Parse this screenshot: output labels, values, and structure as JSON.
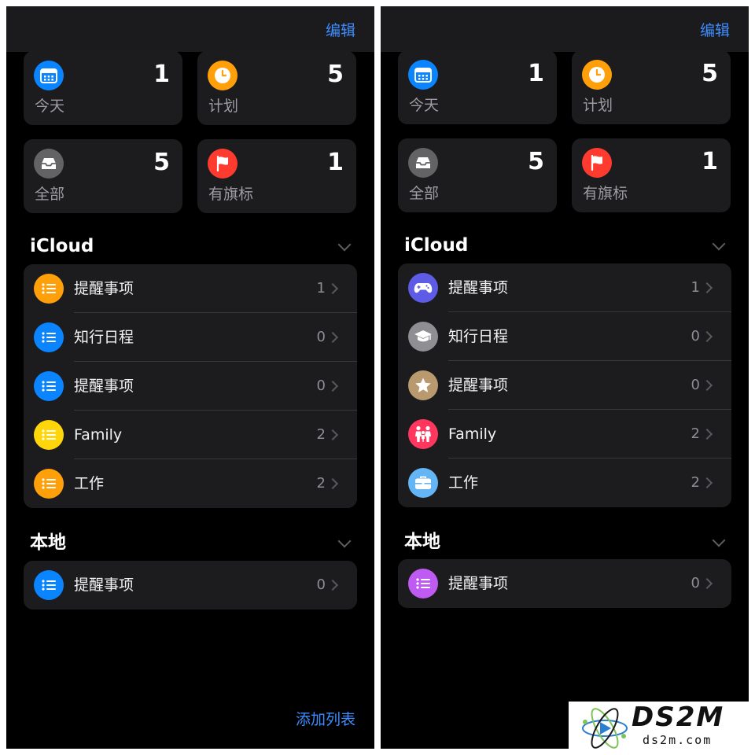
{
  "left": {
    "edit_label": "编辑",
    "tiles": [
      {
        "label": "今天",
        "count": "1",
        "icon": "calendar-icon",
        "color": "#0a84ff"
      },
      {
        "label": "计划",
        "count": "5",
        "icon": "clock-icon",
        "color": "#ff9f0a"
      },
      {
        "label": "全部",
        "count": "5",
        "icon": "tray-icon",
        "color": "#636366"
      },
      {
        "label": "有旗标",
        "count": "1",
        "icon": "flag-icon",
        "color": "#ff3b30"
      }
    ],
    "icloud": {
      "title": "iCloud",
      "items": [
        {
          "label": "提醒事项",
          "count": "1",
          "icon": "list-bullet-icon",
          "color": "#ff9f0a"
        },
        {
          "label": "知行日程",
          "count": "0",
          "icon": "list-bullet-icon",
          "color": "#0a84ff"
        },
        {
          "label": "提醒事项",
          "count": "0",
          "icon": "list-bullet-icon",
          "color": "#0a84ff"
        },
        {
          "label": "Family",
          "count": "2",
          "icon": "list-bullet-icon",
          "color": "#ffd60a"
        },
        {
          "label": "工作",
          "count": "2",
          "icon": "list-bullet-icon",
          "color": "#ff9f0a"
        }
      ]
    },
    "local": {
      "title": "本地",
      "items": [
        {
          "label": "提醒事项",
          "count": "0",
          "icon": "list-bullet-icon",
          "color": "#0a84ff"
        }
      ]
    },
    "add_list_label": "添加列表"
  },
  "right": {
    "edit_label": "编辑",
    "tiles": [
      {
        "label": "今天",
        "count": "1",
        "icon": "calendar-icon",
        "color": "#0a84ff"
      },
      {
        "label": "计划",
        "count": "5",
        "icon": "clock-icon",
        "color": "#ff9f0a"
      },
      {
        "label": "全部",
        "count": "5",
        "icon": "tray-icon",
        "color": "#636366"
      },
      {
        "label": "有旗标",
        "count": "1",
        "icon": "flag-icon",
        "color": "#ff3b30"
      }
    ],
    "icloud": {
      "title": "iCloud",
      "items": [
        {
          "label": "提醒事项",
          "count": "1",
          "icon": "gamecontroller-icon",
          "color": "#5e5ce6"
        },
        {
          "label": "知行日程",
          "count": "0",
          "icon": "graduationcap-icon",
          "color": "#8e8e93"
        },
        {
          "label": "提醒事项",
          "count": "0",
          "icon": "star-icon",
          "color": "#b89a6e"
        },
        {
          "label": "Family",
          "count": "2",
          "icon": "family-icon",
          "color": "#ff375f"
        },
        {
          "label": "工作",
          "count": "2",
          "icon": "briefcase-icon",
          "color": "#64b5f6"
        }
      ]
    },
    "local": {
      "title": "本地",
      "items": [
        {
          "label": "提醒事项",
          "count": "0",
          "icon": "list-bullet-icon",
          "color": "#bf5af2"
        }
      ]
    }
  },
  "watermark": {
    "brand": "DS2M",
    "url": "ds2m.com"
  }
}
